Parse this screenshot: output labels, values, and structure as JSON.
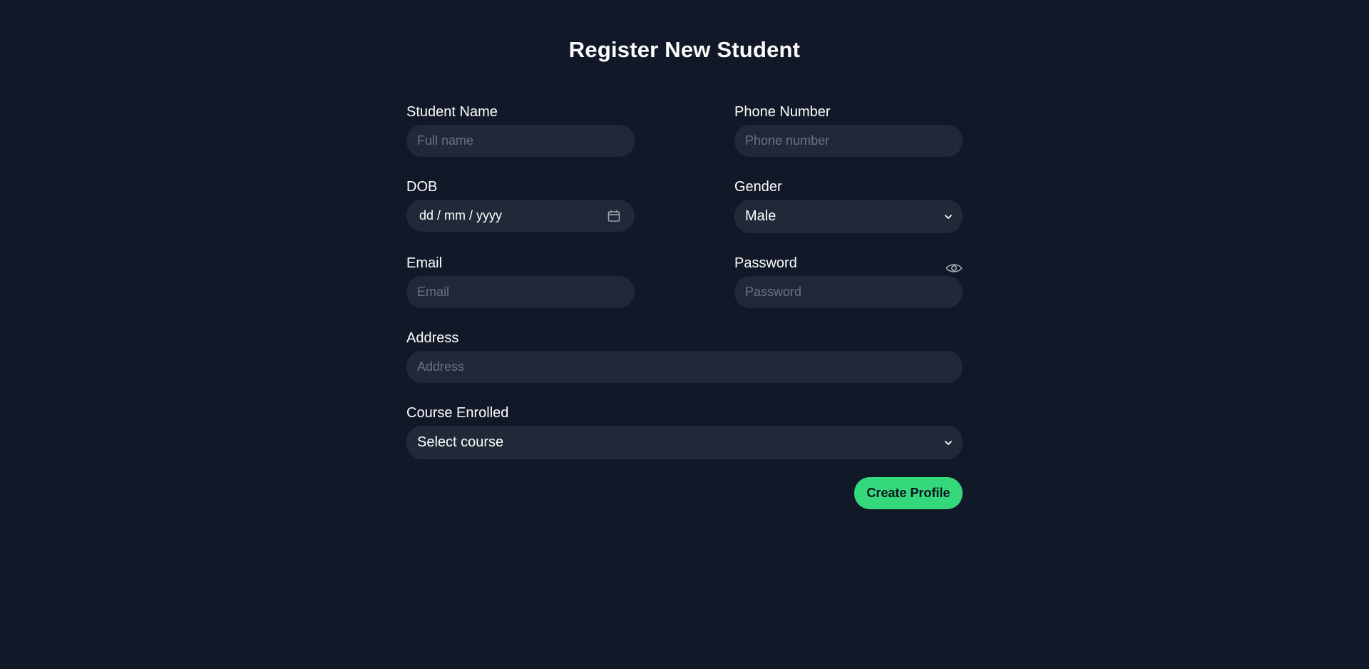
{
  "page": {
    "title": "Register New Student"
  },
  "form": {
    "student_name": {
      "label": "Student Name",
      "placeholder": "Full name",
      "value": ""
    },
    "phone_number": {
      "label": "Phone Number",
      "placeholder": "Phone number",
      "value": ""
    },
    "dob": {
      "label": "DOB",
      "format_text": "dd / mm / yyyy",
      "icon": "calendar-icon"
    },
    "gender": {
      "label": "Gender",
      "selected": "Male",
      "icon": "chevron-down-icon"
    },
    "email": {
      "label": "Email",
      "placeholder": "Email",
      "value": ""
    },
    "password": {
      "label": "Password",
      "placeholder": "Password",
      "value": "",
      "toggle_icon": "eye-icon"
    },
    "address": {
      "label": "Address",
      "placeholder": "Address",
      "value": ""
    },
    "course": {
      "label": "Course Enrolled",
      "selected": "Select course",
      "icon": "chevron-down-icon"
    },
    "submit_label": "Create Profile"
  },
  "colors": {
    "background": "#111827",
    "field_background": "#1f2937",
    "placeholder": "#6b7280",
    "accent": "#34d77a",
    "text": "#ffffff"
  }
}
